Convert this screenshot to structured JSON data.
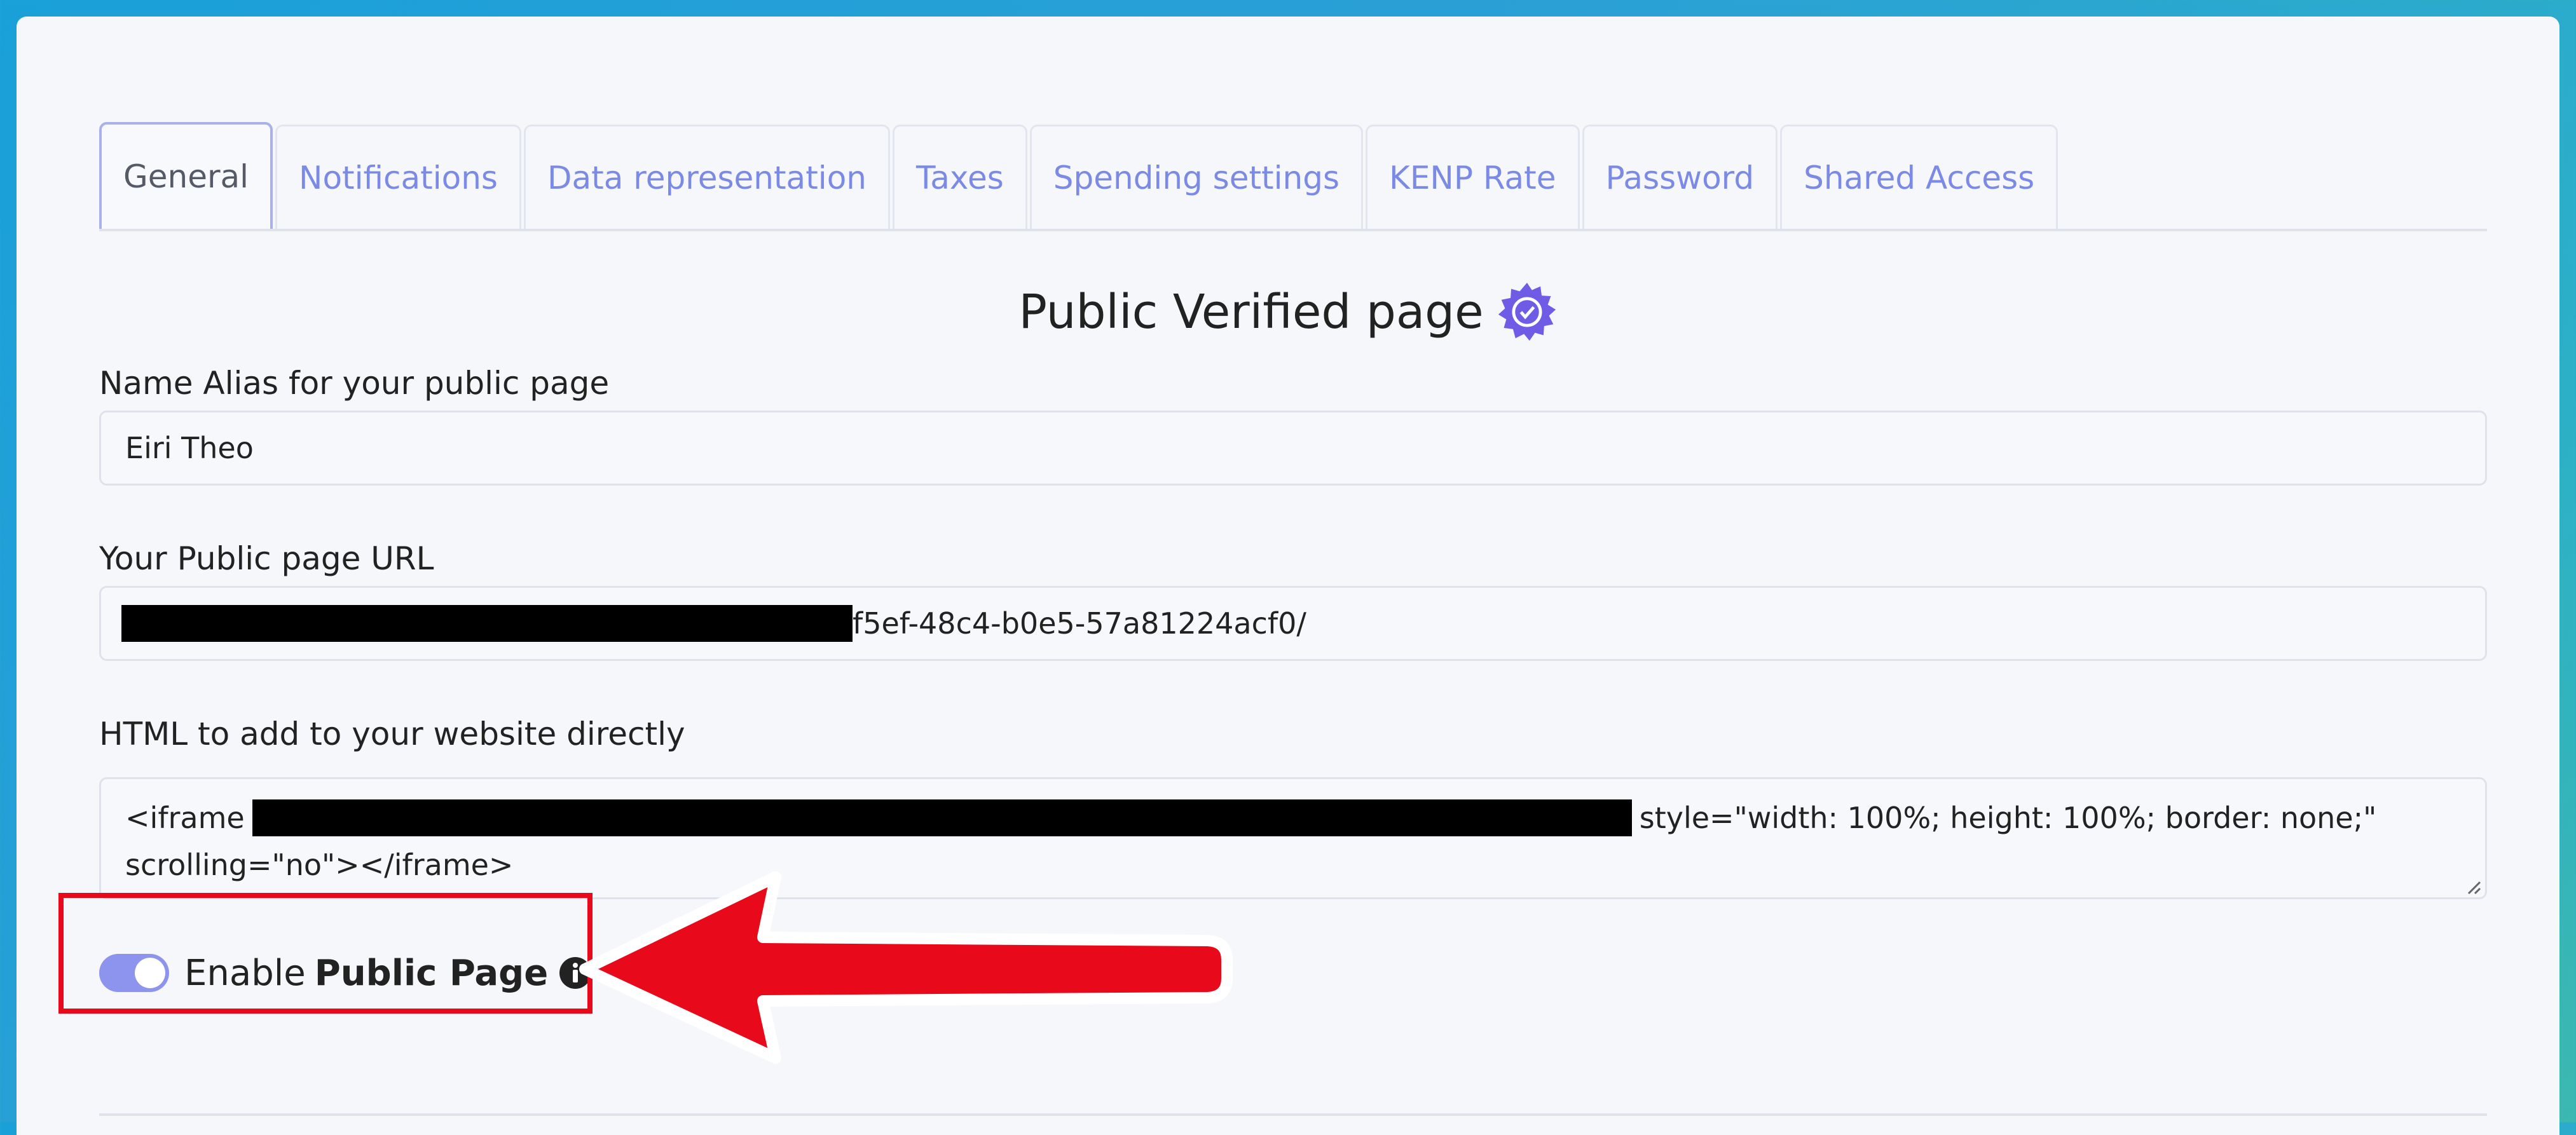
{
  "tabs": [
    {
      "label": "General",
      "active": true
    },
    {
      "label": "Notifications",
      "active": false
    },
    {
      "label": "Data representation",
      "active": false
    },
    {
      "label": "Taxes",
      "active": false
    },
    {
      "label": "Spending settings",
      "active": false
    },
    {
      "label": "KENP Rate",
      "active": false
    },
    {
      "label": "Password",
      "active": false
    },
    {
      "label": "Shared Access",
      "active": false
    }
  ],
  "section": {
    "title": "Public Verified page",
    "badge_icon": "verified-badge-icon",
    "accent_color": "#6f5ce6"
  },
  "alias": {
    "label": "Name Alias for your public page",
    "value": "Eiri Theo"
  },
  "url": {
    "label": "Your Public page URL",
    "visible_value": "f5ef-48c4-b0e5-57a81224acf0/"
  },
  "html_embed": {
    "label": "HTML to add to your website directly",
    "prefix": "<iframe",
    "suffix_line1": "style=\"width: 100%; height: 100%; border: none;\"",
    "line2": "scrolling=\"no\"></iframe>"
  },
  "public_toggle": {
    "prefix": "Enable",
    "bold_label": "Public Page",
    "enabled": true,
    "info_icon": "info-circle-icon",
    "toggle_color": "#8c94ee"
  },
  "annotation": {
    "highlight_color": "#e8091a",
    "arrow_icon": "left-arrow-icon"
  }
}
